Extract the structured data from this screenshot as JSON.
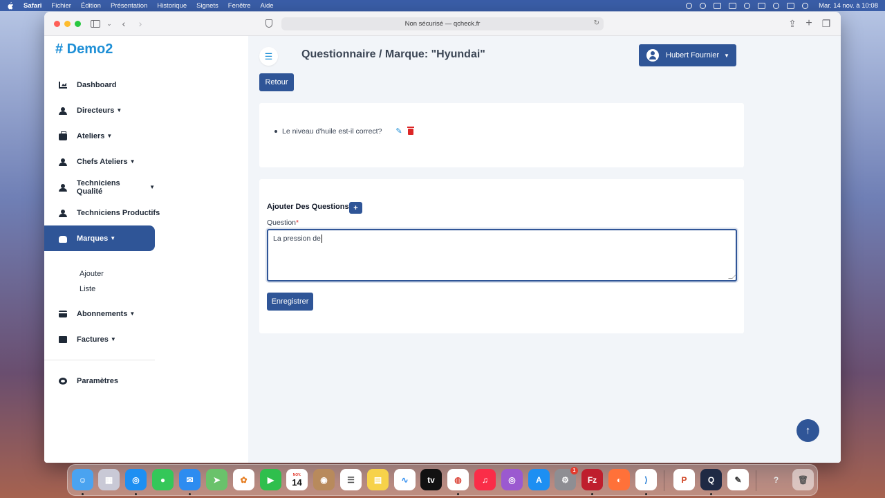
{
  "menubar": {
    "app_name": "Safari",
    "menus": [
      "Fichier",
      "Édition",
      "Présentation",
      "Historique",
      "Signets",
      "Fenêtre",
      "Aide"
    ],
    "clock": "Mar. 14 nov. à 10:08"
  },
  "browser": {
    "url_text": "Non sécurisé — qcheck.fr"
  },
  "sidebar": {
    "brand": "# Demo2",
    "items": [
      {
        "label": "Dashboard",
        "icon": "chart-icon"
      },
      {
        "label": "Directeurs",
        "icon": "users-icon",
        "caret": "▼"
      },
      {
        "label": "Ateliers",
        "icon": "briefcase-icon",
        "caret": "▼"
      },
      {
        "label": "Chefs Ateliers",
        "icon": "users-icon",
        "caret": "▼"
      },
      {
        "label": "Techniciens Qualité",
        "icon": "users-icon",
        "caret": "▼"
      },
      {
        "label": "Techniciens Productifs",
        "icon": "users-icon"
      },
      {
        "label": "Marques",
        "icon": "car-icon",
        "caret": "▼",
        "active": true
      },
      {
        "label": "Abonnements",
        "icon": "credit-card-icon",
        "caret": "▼"
      },
      {
        "label": "Factures",
        "icon": "file-icon",
        "caret": "▼"
      }
    ],
    "sub_items": [
      "Ajouter",
      "Liste"
    ],
    "settings_label": "Paramètres"
  },
  "header": {
    "title": "Questionnaire / Marque: \"Hyundai\"",
    "user_name": "Hubert Fournier"
  },
  "main": {
    "back_label": "Retour",
    "questions": [
      "Le niveau d'huile est-il correct?"
    ],
    "add_section_title": "Ajouter Des Questions",
    "add_button": "+",
    "field_label": "Question",
    "required_mark": "*",
    "textarea_value": "La pression de",
    "save_label": "Enregistrer",
    "scroll_top_icon": "↑"
  },
  "colors": {
    "primary": "#2f5597",
    "brand": "#1e8fd6",
    "danger": "#dc2626"
  },
  "dock": {
    "calendar_month": "NOV.",
    "calendar_day": "14",
    "settings_badge": "1"
  }
}
